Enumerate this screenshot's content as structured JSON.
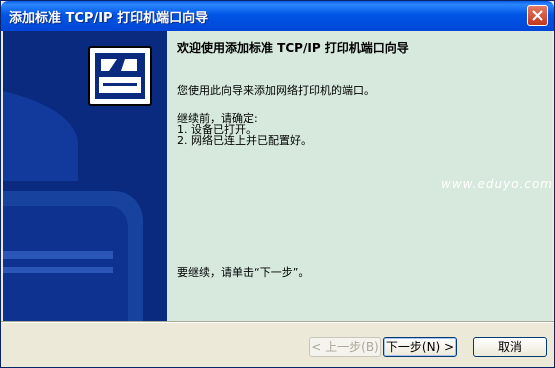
{
  "window": {
    "title": "添加标准 TCP/IP 打印机端口向导"
  },
  "content": {
    "heading": "欢迎使用添加标准 TCP/IP 打印机端口向导",
    "intro": "您使用此向导来添加网络打印机的端口。",
    "before_label": "继续前，请确定:",
    "items": [
      "1.  设备已打开。",
      "2.  网络已连上并已配置好。"
    ],
    "continue_text": "要继续，请单击“下一步”。"
  },
  "watermark": "www.eduyo.com",
  "buttons": {
    "back": "< 上一步(B)",
    "next": "下一步(N) >",
    "cancel": "取消"
  },
  "colors": {
    "sidebar": "#0a2a80",
    "content_bg": "#d6e9dc",
    "titlebar": "#0055e5"
  }
}
